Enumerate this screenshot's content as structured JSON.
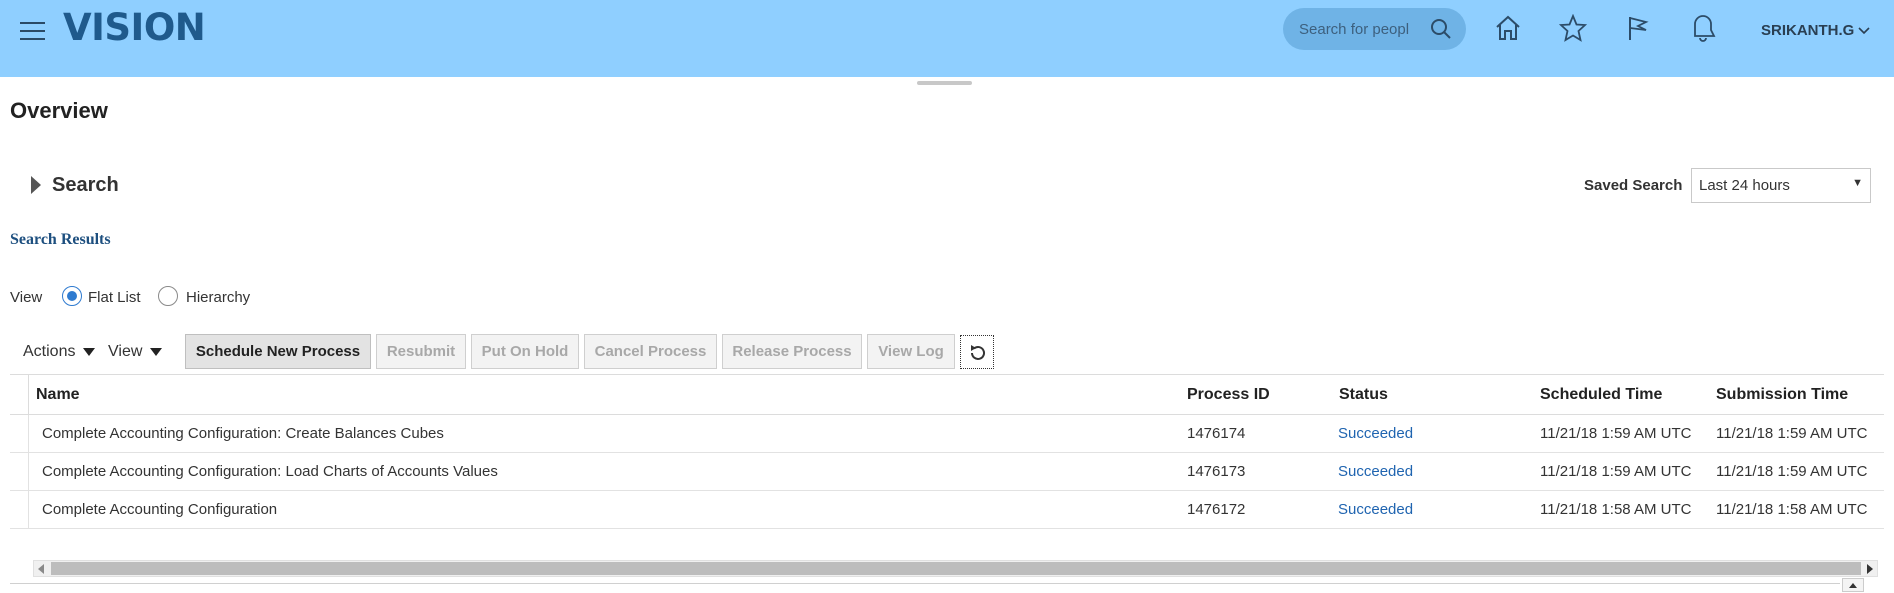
{
  "header": {
    "logo": "VISION",
    "search_placeholder": "Search for people",
    "user": "SRIKANTH.G",
    "icons": [
      "menu-icon",
      "search-icon",
      "home-icon",
      "star-icon",
      "flag-icon",
      "bell-icon",
      "chevron-down-icon"
    ],
    "bg_color": "#8fcfff"
  },
  "page": {
    "title": "Overview"
  },
  "search_panel": {
    "label": "Search",
    "saved_search_label": "Saved Search",
    "saved_search_value": "Last 24 hours"
  },
  "results": {
    "title": "Search Results",
    "view_label": "View",
    "view_options": [
      {
        "label": "Flat List",
        "selected": true
      },
      {
        "label": "Hierarchy",
        "selected": false
      }
    ]
  },
  "toolbar": {
    "actions_label": "Actions",
    "view_label": "View",
    "buttons": [
      {
        "label": "Schedule New Process",
        "enabled": true
      },
      {
        "label": "Resubmit",
        "enabled": false
      },
      {
        "label": "Put On Hold",
        "enabled": false
      },
      {
        "label": "Cancel Process",
        "enabled": false
      },
      {
        "label": "Release Process",
        "enabled": false
      },
      {
        "label": "View Log",
        "enabled": false
      }
    ]
  },
  "table": {
    "columns": [
      "Name",
      "Process ID",
      "Status",
      "Scheduled Time",
      "Submission Time"
    ],
    "rows": [
      {
        "name": "Complete Accounting Configuration: Create Balances Cubes",
        "process_id": "1476174",
        "status": "Succeeded",
        "scheduled": "11/21/18 1:59 AM UTC",
        "submission": "11/21/18 1:59 AM UTC"
      },
      {
        "name": "Complete Accounting Configuration: Load Charts of Accounts Values",
        "process_id": "1476173",
        "status": "Succeeded",
        "scheduled": "11/21/18 1:59 AM UTC",
        "submission": "11/21/18 1:59 AM UTC"
      },
      {
        "name": "Complete Accounting Configuration",
        "process_id": "1476172",
        "status": "Succeeded",
        "scheduled": "11/21/18 1:58 AM UTC",
        "submission": "11/21/18 1:58 AM UTC"
      }
    ]
  },
  "colors": {
    "link": "#1f64b0",
    "results_title": "#1d4f7f"
  }
}
